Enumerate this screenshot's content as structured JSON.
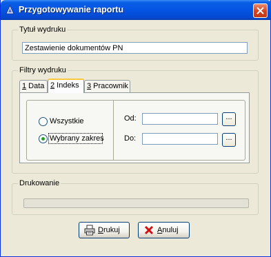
{
  "window": {
    "title": "Przygotowywanie raportu"
  },
  "title_group": {
    "legend": "Tytuł wydruku",
    "value": "Zestawienie dokumentów PN"
  },
  "filters": {
    "legend": "Filtry wydruku",
    "tabs": [
      {
        "key": "1",
        "label": " Data",
        "active": false
      },
      {
        "key": "2",
        "label": " Indeks",
        "active": true
      },
      {
        "key": "3",
        "label": " Pracownik",
        "active": false
      }
    ],
    "radios": [
      {
        "label": "Wszystkie",
        "checked": false
      },
      {
        "label": "Wybrany zakres",
        "checked": true
      }
    ],
    "from_label": "Od:",
    "to_label": "Do:",
    "from_value": "",
    "to_value": "",
    "browse_label": "..."
  },
  "printing": {
    "legend": "Drukowanie",
    "progress": 0
  },
  "buttons": {
    "print": {
      "mnemonic": "D",
      "rest": "rukuj"
    },
    "cancel": {
      "mnemonic": "A",
      "rest": "nuluj"
    }
  }
}
